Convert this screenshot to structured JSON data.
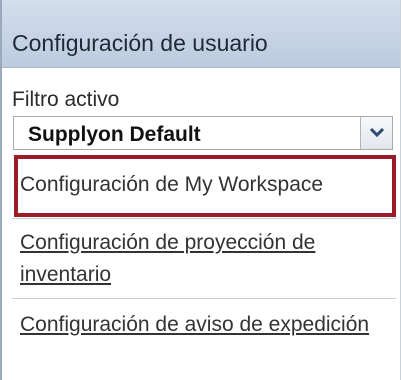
{
  "panel": {
    "title": "Configuración de usuario"
  },
  "filter": {
    "label": "Filtro activo",
    "selected_value": "Supplyon Default",
    "dropdown_icon": "chevron-down-icon"
  },
  "links": {
    "workspace": "Configuración de My Workspace",
    "inventory_projection": "Configuración de proyección de inventario",
    "shipping_notice": "Configuración de aviso de expedición"
  },
  "colors": {
    "header_bg": "#c7d3e6",
    "highlight_border": "#9b1b28",
    "link_text": "#333333"
  }
}
